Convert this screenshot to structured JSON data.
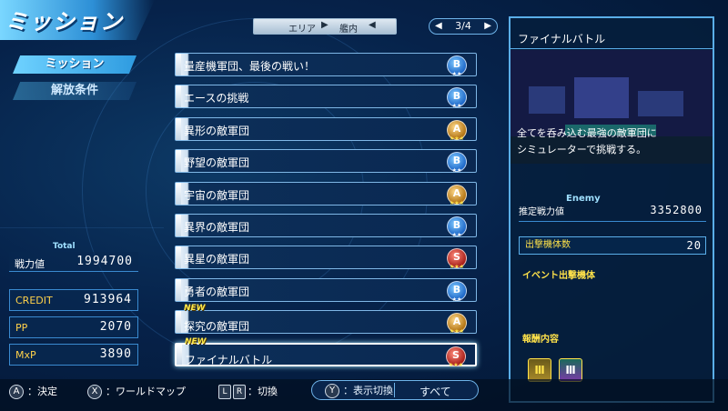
{
  "screen": {
    "title": "ミッション"
  },
  "side_menu": {
    "tabs": [
      {
        "label": "ミッション",
        "active": true
      },
      {
        "label": "解放条件",
        "active": false
      }
    ]
  },
  "stats": {
    "total_label": "Total",
    "power_label": "戦力値",
    "power_value": "1994700",
    "credit_label": "CREDIT",
    "credit_value": "913964",
    "pp_label": "PP",
    "pp_value": "2070",
    "mxp_label": "MxP",
    "mxp_value": "3890"
  },
  "filter": {
    "area_label": "エリア",
    "area_value": "艦内",
    "page": "3/4"
  },
  "missions": [
    {
      "name": "量産機軍団、最後の戦い！",
      "rank": "B",
      "stars": "★★",
      "new": false
    },
    {
      "name": "エースの挑戦",
      "rank": "B",
      "stars": "★★",
      "new": false
    },
    {
      "name": "異形の敵軍団",
      "rank": "A",
      "stars": "★★★",
      "new": false
    },
    {
      "name": "野望の敵軍団",
      "rank": "B",
      "stars": "★★",
      "new": false
    },
    {
      "name": "宇宙の敵軍団",
      "rank": "A",
      "stars": "★★★",
      "new": false
    },
    {
      "name": "異界の敵軍団",
      "rank": "B",
      "stars": "★★",
      "new": false
    },
    {
      "name": "異星の敵軍団",
      "rank": "S",
      "stars": "★★★",
      "new": false
    },
    {
      "name": "勇者の敵軍団",
      "rank": "B",
      "stars": "★★",
      "new": false
    },
    {
      "name": "探究の敵軍団",
      "rank": "A",
      "stars": "★★★",
      "new": true
    },
    {
      "name": "ファイナルバトル",
      "rank": "S",
      "stars": "★★★",
      "new": true,
      "selected": true
    }
  ],
  "new_tag": "NEW",
  "detail": {
    "title": "ファイナルバトル",
    "desc_line1": "全てを呑み込む最強の敵軍団に",
    "desc_line2": "シミュレーターで挑戦する。",
    "enemy_label": "Enemy",
    "enemy_power_label": "推定戦力値",
    "enemy_power_value": "3352800",
    "unit_count_label": "出撃機体数",
    "unit_count_value": "20",
    "event_label": "イベント出撃機体",
    "reward_label": "報酬内容",
    "reward_gold_icon": "Ⅲ",
    "reward_multi_icon": "Ⅲ"
  },
  "controls": {
    "a_key": "A",
    "a_label": "：決定",
    "x_key": "X",
    "x_label": "：ワールドマップ",
    "l_key": "L",
    "r_key": "R",
    "lr_label": "：切換",
    "y_key": "Y",
    "y_label": "：表示切換",
    "view_value": "すべて"
  }
}
